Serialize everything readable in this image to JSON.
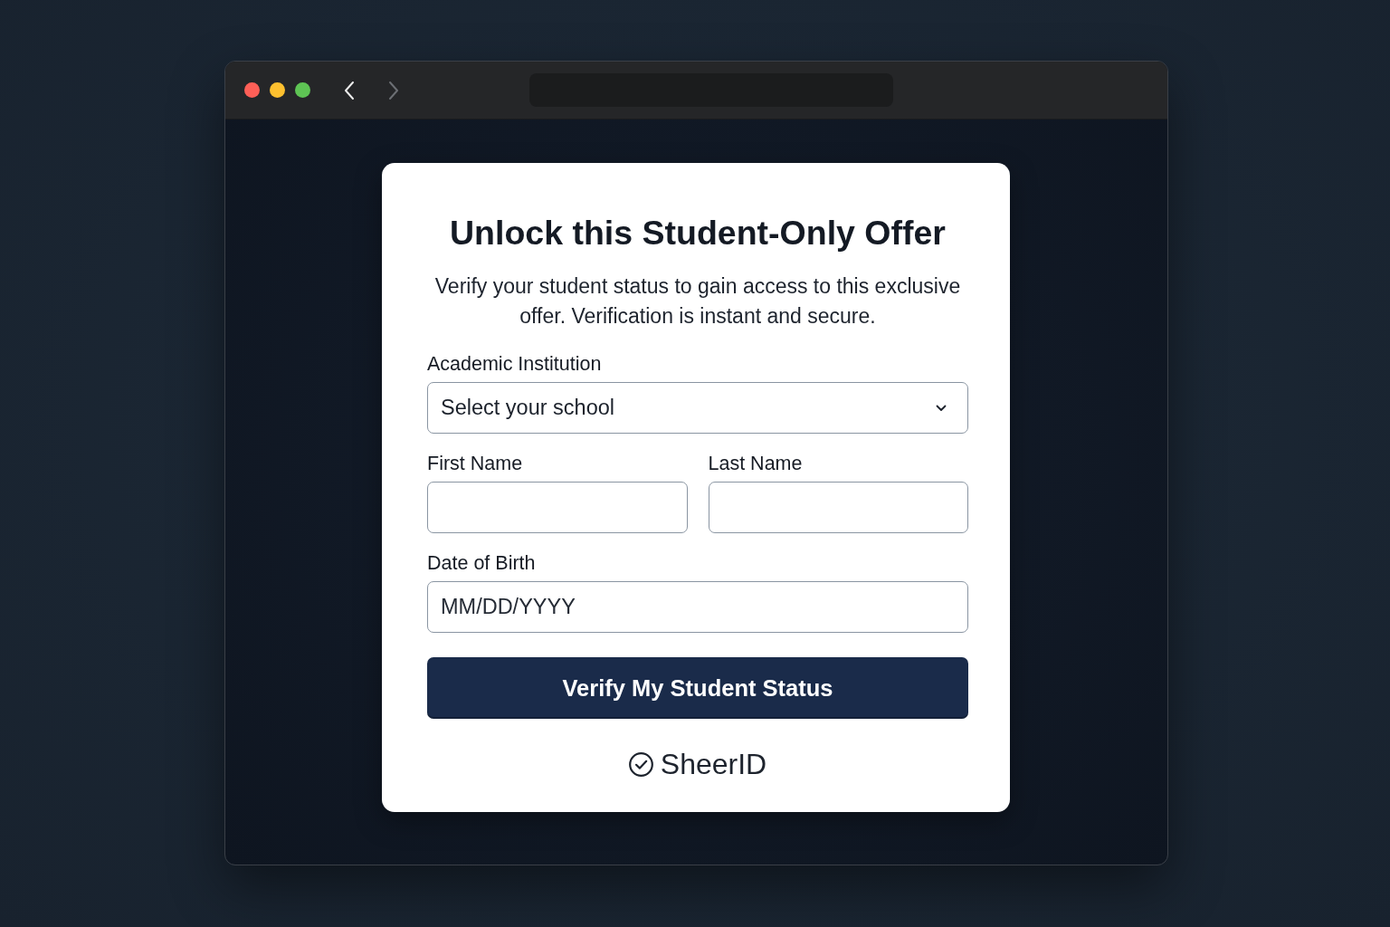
{
  "window": {
    "controls": [
      {
        "color": "#fe5f57"
      },
      {
        "color": "#fdc02f"
      },
      {
        "color": "#5ec454"
      }
    ],
    "nav": [
      {
        "kind": "back",
        "disabled": false
      },
      {
        "kind": "forward",
        "disabled": true
      }
    ]
  },
  "card": {
    "title": "Unlock this Student-Only Offer",
    "description": "Verify your student status to gain access to this exclusive offer. Verification is instant and secure.",
    "form_rows": [
      {
        "fields": [
          {
            "kind": "select",
            "label": "Academic Institution",
            "placeholder": "Select your school"
          }
        ]
      },
      {
        "fields": [
          {
            "kind": "text",
            "label": "First Name"
          },
          {
            "kind": "text",
            "label": "Last Name"
          }
        ]
      },
      {
        "fields": [
          {
            "kind": "date",
            "label": "Date of Birth",
            "placeholder": "MM/DD/YYYY"
          }
        ]
      }
    ],
    "submit_button": "Verify My Student Status",
    "brand": "SheerID"
  }
}
